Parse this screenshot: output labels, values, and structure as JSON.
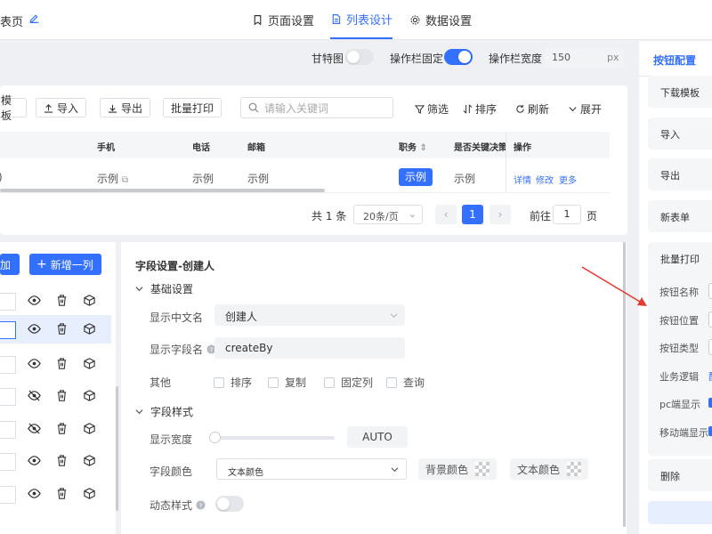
{
  "header": {
    "page_title": "表页",
    "tabs": [
      {
        "label": "页面设置",
        "icon": "bookmark-icon",
        "active": false
      },
      {
        "label": "列表设计",
        "icon": "document-icon",
        "active": true
      },
      {
        "label": "数据设置",
        "icon": "gear-icon",
        "active": false
      }
    ]
  },
  "options": {
    "gantt_label": "甘特图",
    "gantt_on": false,
    "fixed_label": "操作栏固定",
    "fixed_on": true,
    "width_label": "操作栏宽度",
    "width_value": "150",
    "width_unit": "px"
  },
  "toolbar": {
    "template_label": "模板",
    "import_label": "导入",
    "export_label": "导出",
    "batch_print_label": "批量打印",
    "search_placeholder": "请输入关键词",
    "filter_label": "筛选",
    "sort_label": "排序",
    "refresh_label": "刷新",
    "expand_label": "展开"
  },
  "table": {
    "headers": [
      "手机",
      "电话",
      "邮箱",
      "职务",
      "是否关键决策…",
      "操作"
    ],
    "row": {
      "first": "",
      "phone": "示例",
      "tel": "示例",
      "email": "示例",
      "role": "示例",
      "decision": "示例",
      "actions": [
        "详情",
        "修改",
        "更多"
      ]
    }
  },
  "pager": {
    "total": "共 1 条",
    "size": "20条/页",
    "prev": "‹",
    "page": "1",
    "next": "›",
    "goto_label": "前往",
    "goto_value": "1",
    "page_suffix": "页"
  },
  "field_list": {
    "add_label": "加",
    "new_column_label": "新增一列",
    "rows": 7,
    "selected_index": 1
  },
  "settings": {
    "title": "字段设置-创建人",
    "basic_section": "基础设置",
    "display_cn_label": "显示中文名",
    "display_cn_value": "创建人",
    "field_name_label": "显示字段名",
    "field_name_value": "createBy",
    "other_label": "其他",
    "checkboxes": [
      "排序",
      "复制",
      "固定列",
      "查询"
    ],
    "style_section": "字段样式",
    "display_width_label": "显示宽度",
    "display_width_value": "AUTO",
    "field_color_label": "字段颜色",
    "field_color_value": "文本颜色",
    "bg_color_label": "背景颜色",
    "text_color_label": "文本颜色",
    "dynamic_style_label": "动态样式"
  },
  "right_panel": {
    "tab_label": "按钮配置",
    "buttons": [
      "下载模板",
      "导入",
      "导出",
      "新表单",
      "批量打印"
    ],
    "fields": [
      "按钮名称",
      "按钮位置",
      "按钮类型",
      "业务逻辑",
      "pc端显示",
      "移动端显示"
    ],
    "logic_link": "配",
    "delete_label": "删除"
  },
  "colors": {
    "primary": "#3370ff",
    "annotation_arrow": "#e8392e"
  }
}
